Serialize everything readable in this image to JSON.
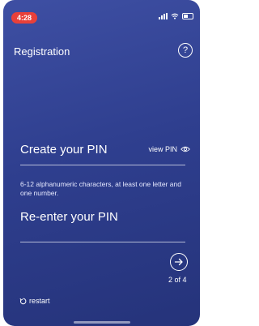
{
  "status_bar": {
    "time": "4:28",
    "accent_color": "#e8403a",
    "icons": [
      "signal-icon",
      "wifi-icon",
      "battery-icon"
    ]
  },
  "header": {
    "title": "Registration",
    "help_label": "?"
  },
  "form": {
    "create_pin_label": "Create your PIN",
    "view_pin_label": "view PIN",
    "hint": "6-12 alphanumeric characters, at least one letter and one number.",
    "reenter_pin_label": "Re-enter your PIN",
    "step": "2 of 4",
    "restart_label": "restart"
  },
  "colors": {
    "background": "#2f3f8f",
    "text": "#ffffff"
  }
}
